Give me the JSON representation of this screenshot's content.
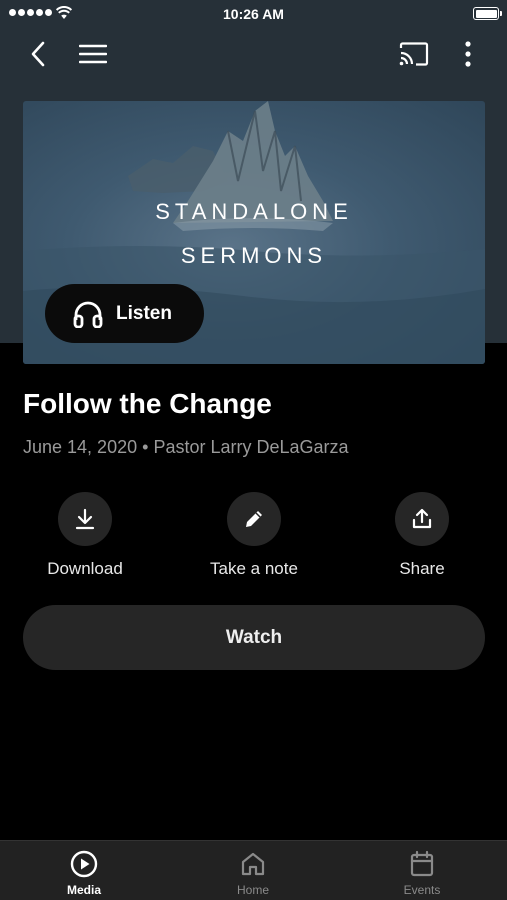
{
  "status_bar": {
    "time": "10:26 AM"
  },
  "nav": {
    "back_icon": "chevron-left-icon",
    "menu_icon": "hamburger-menu-icon",
    "cast_icon": "cast-icon",
    "more_icon": "more-vertical-icon"
  },
  "hero": {
    "line1": "STANDALONE",
    "line2": "SERMONS",
    "listen_label": "Listen",
    "listen_icon": "headphones-icon"
  },
  "sermon": {
    "title": "Follow the Change",
    "date": "June 14, 2020",
    "separator": "•",
    "speaker": "Pastor Larry DeLaGarza"
  },
  "actions": [
    {
      "label": "Download",
      "icon": "download-icon"
    },
    {
      "label": "Take a note",
      "icon": "pencil-icon"
    },
    {
      "label": "Share",
      "icon": "share-icon"
    }
  ],
  "watch_label": "Watch",
  "tabs": [
    {
      "label": "Media",
      "icon": "play-circle-icon",
      "active": true
    },
    {
      "label": "Home",
      "icon": "home-icon",
      "active": false
    },
    {
      "label": "Events",
      "icon": "calendar-icon",
      "active": false
    }
  ],
  "colors": {
    "background": "#000000",
    "header_bg": "#263038",
    "button_bg": "#262626",
    "tabbar_bg": "#222222",
    "muted_text": "#9a9a9a"
  }
}
